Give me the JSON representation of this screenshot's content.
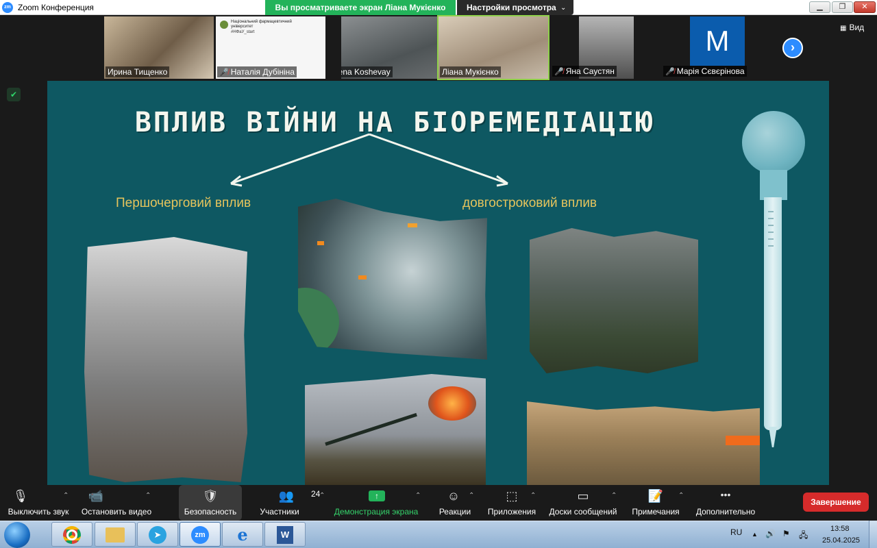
{
  "window": {
    "app_logo": "zm",
    "title": "Zoom Конференция",
    "share_banner": "Вы просматриваете экран Ліана Мукієнко",
    "view_options": "Настройки просмотра",
    "view_options_chevron": "⌄",
    "minimize": "▁",
    "restore": "❐",
    "close": "✕"
  },
  "participants": {
    "tiles": [
      {
        "name": "Ирина Тищенко",
        "muted": false
      },
      {
        "name": "Наталія Дубініна",
        "muted": true
      },
      {
        "name": "Elena Koshevay",
        "muted": false
      },
      {
        "name": "Ліана Мукієнко",
        "muted": false,
        "active_speaker": true
      },
      {
        "name": "Яна Саустян",
        "muted": true
      },
      {
        "name": "Марія Сєвєрінова",
        "muted": true,
        "avatar_letter": "M",
        "avatar_color": "#0b5cad"
      }
    ],
    "tile2_logo_text": "Національний фармацевтичний університет",
    "tile2_tag": "#НФаУ_start",
    "next_page": "›",
    "view_toggle": "Вид",
    "mic_off_icon": "🎤̸"
  },
  "slide": {
    "title": "ВПЛИВ ВІЙНИ НА БІОРЕМЕДІАЦІЮ",
    "label_primary": "Першочерговий вплив",
    "label_longterm": "довгостроковий вплив",
    "background_color": "#0e5862",
    "title_color": "#f4f6ee",
    "label_color": "#e6c45c"
  },
  "toolbar": {
    "mute": {
      "label": "Выключить звук",
      "icon": "🎙"
    },
    "video": {
      "label": "Остановить видео",
      "icon": "📹"
    },
    "security": {
      "label": "Безопасность",
      "icon": "🛡"
    },
    "participants": {
      "label": "Участники",
      "icon": "👥",
      "count": "24"
    },
    "share": {
      "label": "Демонстрация экрана",
      "icon": "↑",
      "color": "#35d26b"
    },
    "reactions": {
      "label": "Реакции",
      "icon": "☺"
    },
    "apps": {
      "label": "Приложения",
      "icon": "⬚"
    },
    "whiteboards": {
      "label": "Доски сообщений",
      "icon": "▭"
    },
    "notes": {
      "label": "Примечания",
      "icon": "📝"
    },
    "more": {
      "label": "Дополнительно",
      "icon": "•••"
    },
    "caret": "⌃",
    "end": {
      "label": "Завершение",
      "color": "#d62b2b"
    }
  },
  "taskbar": {
    "zoom_label": "zm",
    "telegram_icon": "➤",
    "word_icon": "W",
    "ie_icon": "e",
    "lang": "RU",
    "tray_up": "▲",
    "tray_volume": "🔊",
    "tray_flag": "⚑",
    "tray_network": "🖧",
    "time": "13:58",
    "date": "25.04.2025"
  }
}
